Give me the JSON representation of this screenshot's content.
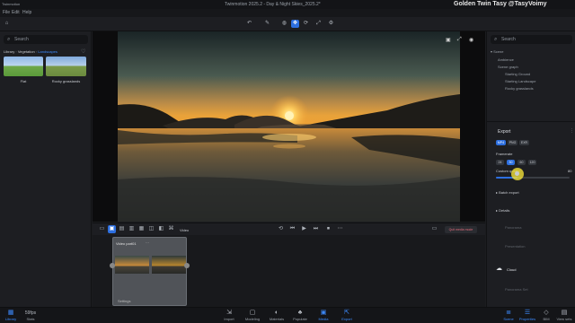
{
  "window": {
    "app_name": "Twinmotion",
    "title": "Twinmotion 2025.2 - Day & Night Skies_2025.2*",
    "watermark": "Golden Twin Tasy @TasyVoimy"
  },
  "menu": [
    "File",
    "Edit",
    "Help"
  ],
  "left_panel": {
    "search_placeholder": "Search",
    "breadcrumb": [
      "Library",
      "Vegetation",
      "Landscapes"
    ],
    "thumbnails": [
      {
        "label": "Flat"
      },
      {
        "label": "Rocky grasslands"
      }
    ]
  },
  "timeline": {
    "toolbar_label": "Video",
    "clip_title": "Video part01",
    "clip_settings_label": "Settings",
    "create_button": "Quit media mode"
  },
  "right_panel": {
    "search_placeholder": "Search",
    "scene_items": [
      "Scene",
      "Ambience",
      "Scene graph",
      "Starting Ground",
      "Starting Landscape",
      "Rocky grasslands"
    ],
    "export": {
      "title": "Export",
      "format_tabs": [
        "MP4",
        "PNG",
        "EXR"
      ],
      "framerate_label": "Framerate",
      "framerate_options": [
        "24",
        "30",
        "60",
        "120"
      ],
      "quality_label": "Custom quality",
      "quality_value": "80",
      "sections": [
        "Batch export",
        "Details",
        "Panorama",
        "Presentation",
        "Cloud",
        "Panorama Set"
      ]
    }
  },
  "bottom_bar": {
    "left": [
      {
        "label": "Library",
        "icon": "library-icon"
      },
      {
        "label": "Stats",
        "value": "59fps",
        "icon": "stats-icon"
      }
    ],
    "center": [
      {
        "label": "Import",
        "icon": "import-icon"
      },
      {
        "label": "Modeling",
        "icon": "modeling-icon"
      },
      {
        "label": "Materials",
        "icon": "materials-icon"
      },
      {
        "label": "Populate",
        "icon": "populate-icon"
      },
      {
        "label": "Media",
        "icon": "media-icon"
      },
      {
        "label": "Export",
        "icon": "export-icon"
      }
    ],
    "right": [
      {
        "label": "Scene",
        "icon": "scene-icon"
      },
      {
        "label": "Properties",
        "icon": "properties-icon"
      },
      {
        "label": "BIM",
        "icon": "bim-icon"
      },
      {
        "label": "View sets",
        "icon": "viewsets-icon"
      }
    ]
  },
  "colors": {
    "accent": "#2d6fe0",
    "cursor_highlight": "#f2e03a",
    "create_button": "#e06a7a"
  }
}
